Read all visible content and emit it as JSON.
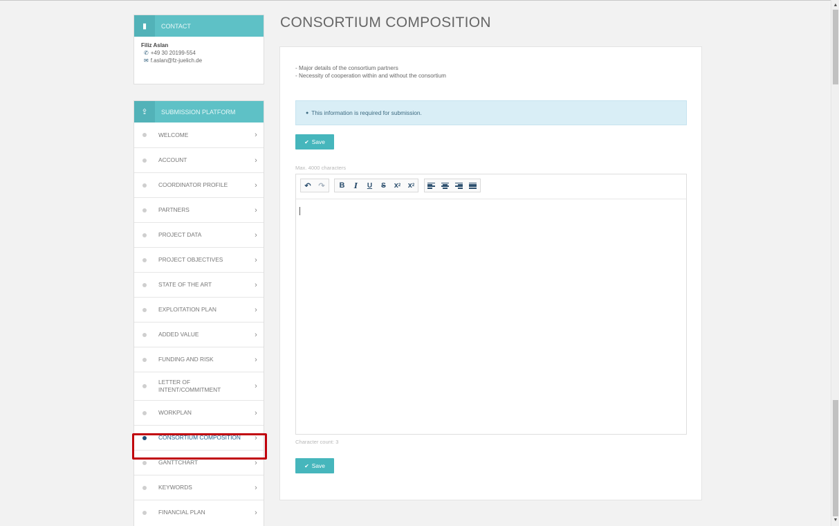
{
  "contact": {
    "header": "CONTACT",
    "name": "Filiz Aslan",
    "phone": "+49 30 20199-554",
    "email": "f.aslan@fz-juelich.de"
  },
  "nav": {
    "header": "SUBMISSION PLATFORM",
    "items": [
      {
        "label": "WELCOME"
      },
      {
        "label": "ACCOUNT"
      },
      {
        "label": "COORDINATOR PROFILE"
      },
      {
        "label": "PARTNERS"
      },
      {
        "label": "PROJECT DATA"
      },
      {
        "label": "PROJECT OBJECTIVES"
      },
      {
        "label": "STATE OF THE ART"
      },
      {
        "label": "EXPLOITATION PLAN"
      },
      {
        "label": "ADDED VALUE"
      },
      {
        "label": "FUNDING AND RISK"
      },
      {
        "label": "LETTER OF INTENT/COMMITMENT"
      },
      {
        "label": "WORKPLAN"
      },
      {
        "label": "CONSORTIUM COMPOSITION",
        "active": true
      },
      {
        "label": "GANTTCHART"
      },
      {
        "label": "KEYWORDS"
      },
      {
        "label": "FINANCIAL PLAN"
      }
    ]
  },
  "main": {
    "title": "CONSORTIUM COMPOSITION",
    "desc_line1": "- Major details of the consortium partners",
    "desc_line2": "- Necessity of cooperation within and without the consortium",
    "info": "This information is required for submission.",
    "save_label": "Save",
    "max_chars": "Max. 4000 characters",
    "char_count": "Character count: 3"
  },
  "colors": {
    "accent": "#46b6bc",
    "active_nav": "#1f4e79",
    "highlight_border": "#c0000b"
  }
}
